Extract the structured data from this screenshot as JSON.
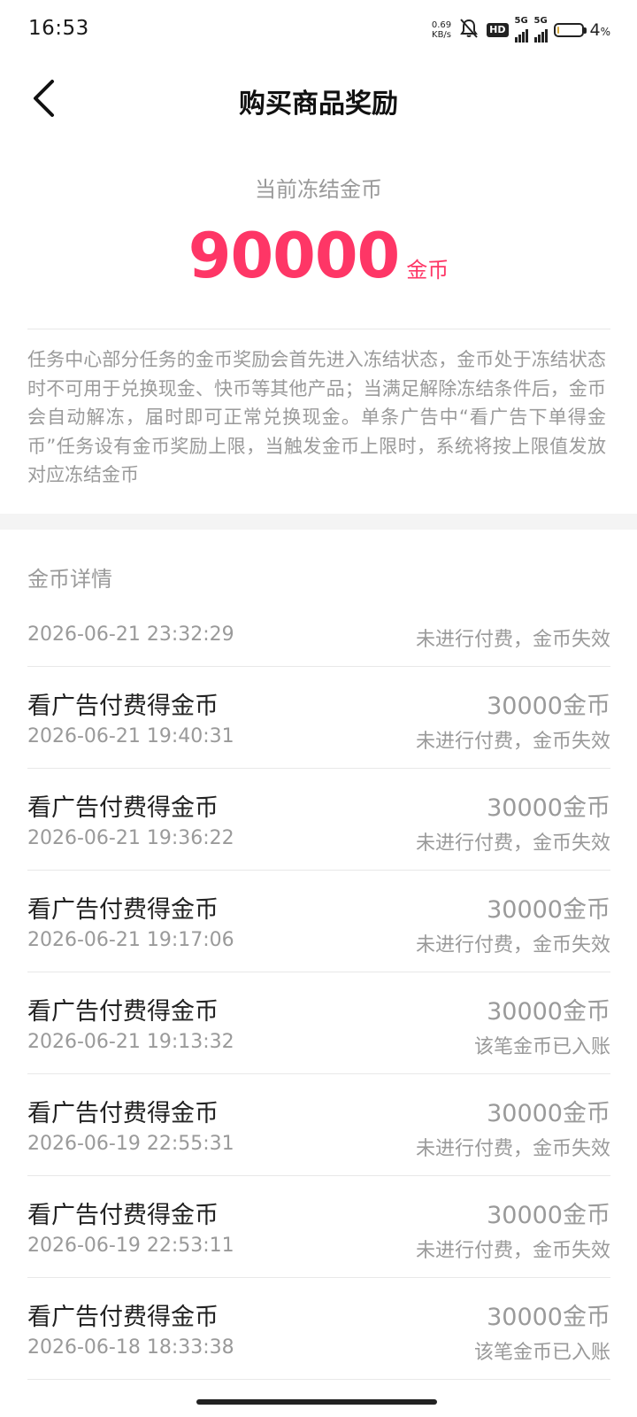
{
  "status_bar": {
    "time": "16:53",
    "net_speed_value": "0.69",
    "net_speed_unit": "KB/s",
    "mute_icon": "bell-off-icon",
    "hd_label": "HD",
    "sim1_label": "5G",
    "sim2_label": "5G",
    "battery_percent": "4",
    "battery_percent_symbol": "%",
    "battery_level": 0.04
  },
  "header": {
    "back_icon": "chevron-left-icon",
    "title": "购买商品奖励"
  },
  "summary": {
    "label": "当前冻结金币",
    "amount": "90000",
    "unit": "金币",
    "accent_color": "#fe3666"
  },
  "description": "任务中心部分任务的金币奖励会首先进入冻结状态，金币处于冻结状态时不可用于兑换现金、快币等其他产品；当满足解除冻结条件后，金币会自动解冻，届时即可正常兑换现金。单条广告中“看广告下单得金币”任务设有金币奖励上限，当触发金币上限时，系统将按上限值发放对应冻结金币",
  "details": {
    "title": "金币详情",
    "first_record": {
      "date": "2026-06-21 23:32:29",
      "status": "未进行付费，金币失效"
    },
    "records": [
      {
        "title": "看广告付费得金币",
        "date": "2026-06-21 19:40:31",
        "amount": "30000金币",
        "status": "未进行付费，金币失效"
      },
      {
        "title": "看广告付费得金币",
        "date": "2026-06-21 19:36:22",
        "amount": "30000金币",
        "status": "未进行付费，金币失效"
      },
      {
        "title": "看广告付费得金币",
        "date": "2026-06-21 19:17:06",
        "amount": "30000金币",
        "status": "未进行付费，金币失效"
      },
      {
        "title": "看广告付费得金币",
        "date": "2026-06-21 19:13:32",
        "amount": "30000金币",
        "status": "该笔金币已入账"
      },
      {
        "title": "看广告付费得金币",
        "date": "2026-06-19 22:55:31",
        "amount": "30000金币",
        "status": "未进行付费，金币失效"
      },
      {
        "title": "看广告付费得金币",
        "date": "2026-06-19 22:53:11",
        "amount": "30000金币",
        "status": "未进行付费，金币失效"
      },
      {
        "title": "看广告付费得金币",
        "date": "2026-06-18 18:33:38",
        "amount": "30000金币",
        "status": "该笔金币已入账"
      }
    ]
  }
}
